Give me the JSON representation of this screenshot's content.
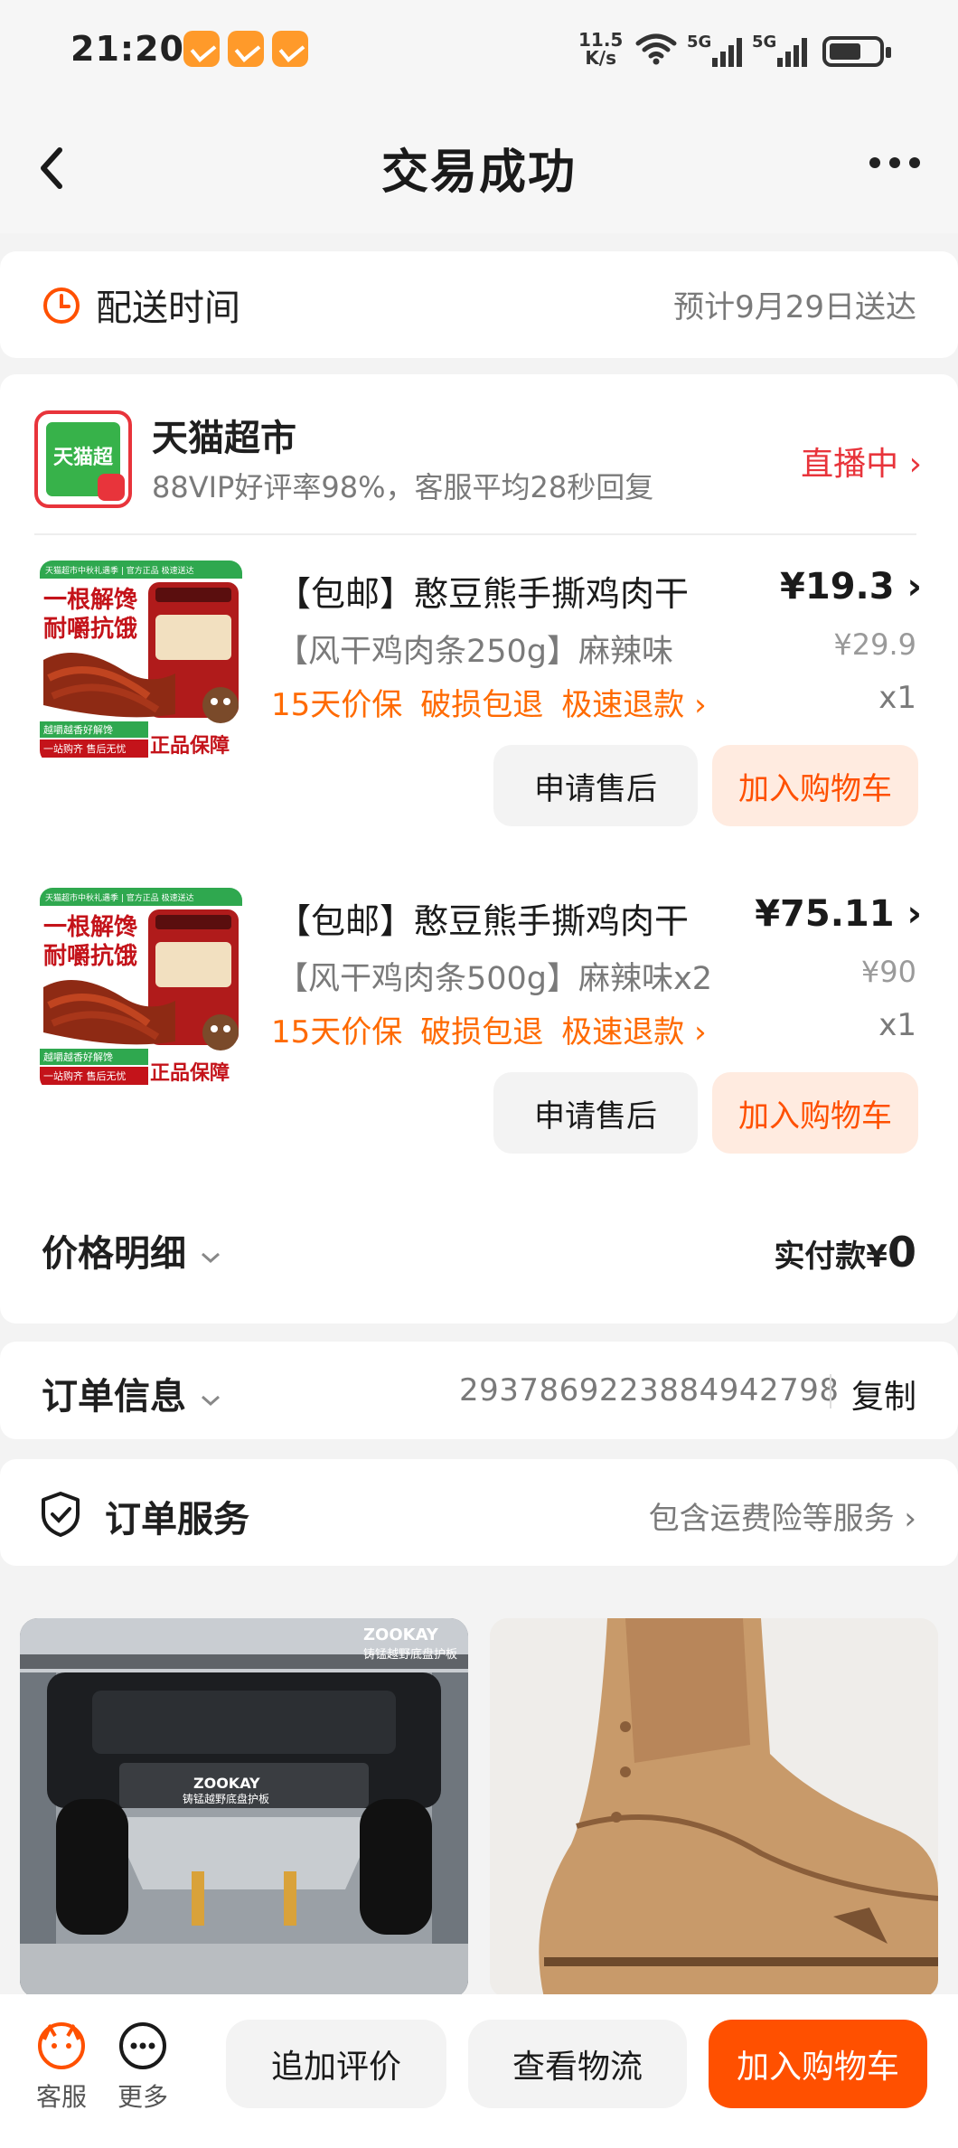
{
  "status_bar": {
    "time": "21:20",
    "net_speed_value": "11.5",
    "net_speed_unit": "K/s",
    "signal1": "5G",
    "signal2": "5G"
  },
  "header": {
    "title": "交易成功"
  },
  "delivery": {
    "label": "配送时间",
    "value": "预计9月29日送达"
  },
  "shop": {
    "logo_text": "天猫超市",
    "name": "天猫超市",
    "subtitle": "88VIP好评率98%，客服平均28秒回复",
    "live_label": "直播中 ›"
  },
  "items": [
    {
      "name": "【包邮】憨豆熊手撕鸡肉干",
      "price": "¥19.3",
      "spec": "【风干鸡肉条250g】麻辣味",
      "original_price": "¥29.9",
      "tags": [
        "15天价保",
        "破损包退",
        "极速退款 ›"
      ],
      "quantity": "x1",
      "after_sale_label": "申请售后",
      "add_cart_label": "加入购物车"
    },
    {
      "name": "【包邮】憨豆熊手撕鸡肉干",
      "price": "¥75.11",
      "spec": "【风干鸡肉条500g】麻辣味x2",
      "original_price": "¥90",
      "tags": [
        "15天价保",
        "破损包退",
        "极速退款 ›"
      ],
      "quantity": "x1",
      "after_sale_label": "申请售后",
      "add_cart_label": "加入购物车"
    }
  ],
  "product_image_text": {
    "top_line": "天猫超市中秋礼遇季 | 官方正品 极速送达",
    "headline1": "一根解馋",
    "headline2": "耐嚼抗饿",
    "badge": "正品保障",
    "footer1": "越嚼越香好解馋",
    "footer2": "一站购齐 售后无忧"
  },
  "price_detail": {
    "label": "价格明细",
    "paid_label": "实付款¥",
    "paid_value": "0"
  },
  "order_info": {
    "label": "订单信息",
    "number": "2937869223884942798",
    "copy_label": "复制"
  },
  "order_service": {
    "label": "订单服务",
    "value": "包含运费险等服务 ›"
  },
  "recommendations": {
    "card1_brand": "ZOOKAY",
    "card1_caption": "铸锰越野底盘护板",
    "card1_plate_brand": "ZOOKAY",
    "card1_plate_caption": "铸锰越野底盘护板"
  },
  "bottom_bar": {
    "service_label": "客服",
    "more_label": "更多",
    "review_label": "追加评价",
    "logistics_label": "查看物流",
    "add_cart_label": "加入购物车"
  },
  "colors": {
    "accent": "#ff5000",
    "live_red": "#e8343b",
    "tag_orange": "#ff6a00",
    "tmall_green": "#37b24a"
  }
}
